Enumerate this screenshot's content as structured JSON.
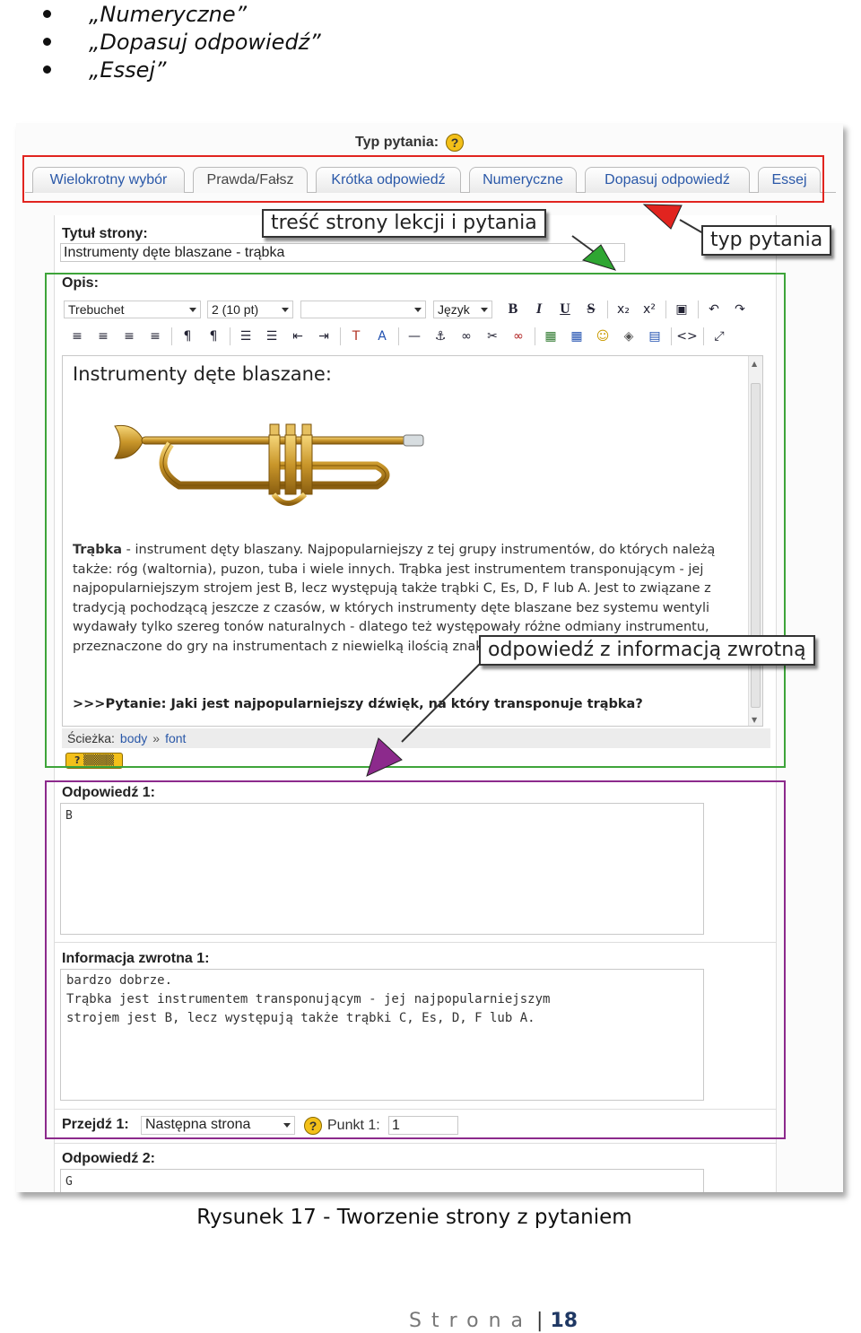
{
  "bullets": [
    "„Numeryczne”",
    "„Dopasuj odpowiedź”",
    "„Essej”"
  ],
  "question_type": {
    "label": "Typ pytania:",
    "help": "?"
  },
  "tabs": [
    "Wielokrotny wybór",
    "Prawda/Fałsz",
    "Krótka odpowiedź",
    "Numeryczne",
    "Dopasuj odpowiedź",
    "Essej"
  ],
  "page_title": {
    "label": "Tytuł strony:",
    "value": "Instrumenty dęte blaszane - trąbka"
  },
  "description": {
    "label": "Opis:",
    "font_family": "Trebuchet",
    "font_size": "2 (10 pt)",
    "format": "",
    "language": "Język",
    "toolbar1": [
      "B",
      "I",
      "U",
      "S",
      "x₂",
      "x²",
      "▣",
      "↶",
      "↷"
    ],
    "toolbar2": [
      "≡",
      "≡",
      "≡",
      "≡",
      "¶",
      "¶",
      "☰",
      "☰",
      "⇤",
      "⇥",
      "T",
      "A",
      "—",
      "⚓",
      "∞",
      "✂",
      "∞",
      "▦",
      "▦",
      "☺",
      "◈",
      "▤",
      "<>",
      "⤢"
    ],
    "editor_title": "Instrumenty dęte blaszane:",
    "editor_body_strong": "Trąbka",
    "editor_body": " - instrument dęty blaszany. Najpopularniejszy z tej grupy instrumentów, do których należą także: róg (waltornia), puzon, tuba i wiele innych. Trąbka jest instrumentem transponującym - jej najpopularniejszym strojem jest B, lecz występują także trąbki C, Es, D, F lub A. Jest to związane z tradycją pochodzącą jeszcze z czasów, w których instrumenty dęte blaszane bez systemu wentyli wydawały tylko szereg tonów naturalnych - dlatego też występowały różne odmiany instrumentu, przeznaczone do gry na instrumentach z niewielką ilością znaków przykluczowych).",
    "editor_question": ">>>Pytanie: Jaki jest najpopularniejszy dźwięk, na który transponuje trąbka?",
    "path_label": "Ścieżka:",
    "path_body": "body",
    "path_sep": "»",
    "path_font": "font"
  },
  "answer1": {
    "label": "Odpowiedź 1:",
    "value": "B"
  },
  "feedback1": {
    "label": "Informacja zwrotna 1:",
    "lines": [
      "bardzo dobrze.",
      "Trąbka jest instrumentem transponującym - jej najpopularniejszym",
      "strojem jest B, lecz występują także trąbki C, Es, D, F lub A."
    ]
  },
  "jump1": {
    "label": "Przejdź 1:",
    "value": "Następna strona",
    "help": "?",
    "score_label": "Punkt 1:",
    "score_value": "1"
  },
  "answer2": {
    "label": "Odpowiedź 2:",
    "value": "G"
  },
  "callouts": {
    "content": "treść strony lekcji i pytania",
    "type": "typ pytania",
    "answer": "odpowiedź z informacją zwrotną"
  },
  "colors": {
    "red": "#e1241f",
    "green": "#3ea43a",
    "purple": "#8c2a8c"
  },
  "caption": "Rysunek 17 - Tworzenie strony z pytaniem",
  "footer": {
    "word": "Strona",
    "sep": "|",
    "page": "18"
  }
}
